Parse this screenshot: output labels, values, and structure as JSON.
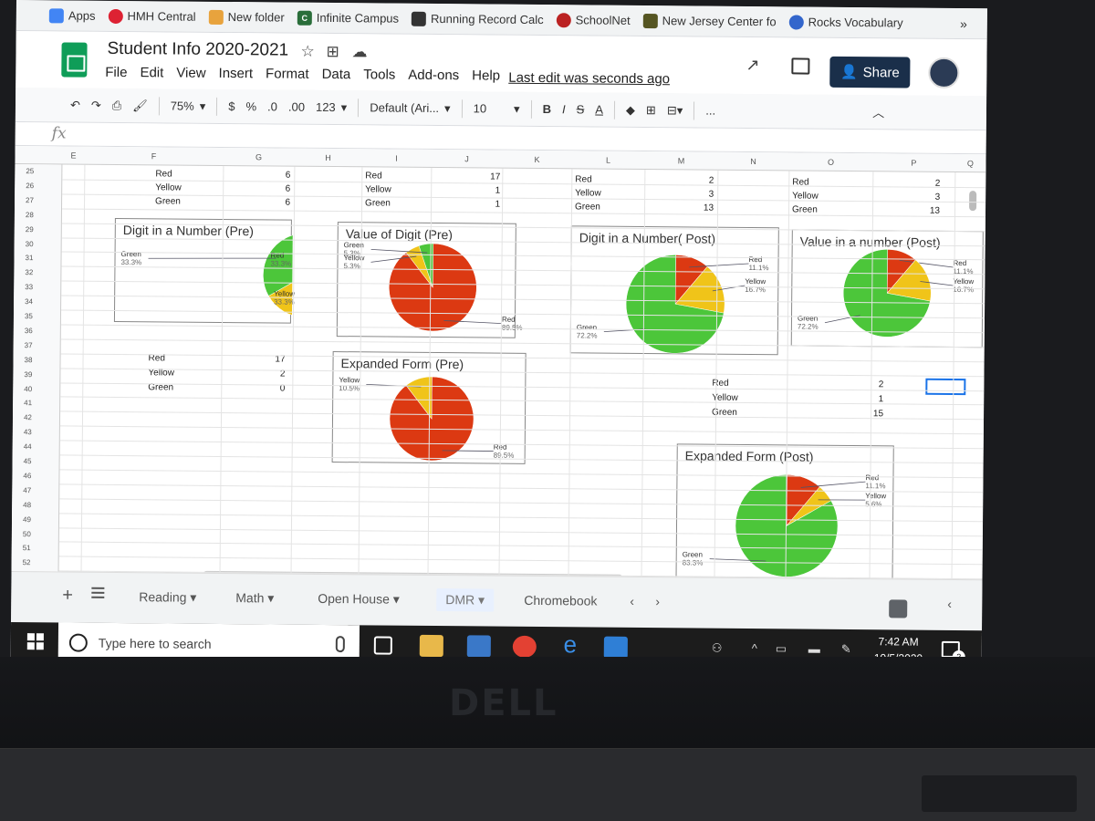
{
  "bookmarks": [
    "Apps",
    "HMH Central",
    "New folder",
    "Infinite Campus",
    "Running Record Calc",
    "SchoolNet",
    "New Jersey Center fo",
    "Rocks Vocabulary"
  ],
  "bookmark_more": "»",
  "doc": {
    "title": "Student Info 2020-2021",
    "menu": [
      "File",
      "Edit",
      "View",
      "Insert",
      "Format",
      "Data",
      "Tools",
      "Add-ons",
      "Help"
    ],
    "last_edit": "Last edit was seconds ago",
    "share": "Share"
  },
  "toolbar": {
    "zoom": "75%",
    "currency": "$",
    "percent": "%",
    "dec_less": ".0",
    "dec_more": ".00",
    "format123": "123",
    "font": "Default (Ari...",
    "size": "10",
    "bold": "B",
    "italic": "I",
    "strike": "S",
    "color_a": "A",
    "more": "..."
  },
  "fx": "fx",
  "columns": [
    "E",
    "F",
    "G",
    "H",
    "I",
    "J",
    "K",
    "L",
    "M",
    "N",
    "O",
    "P",
    "Q"
  ],
  "rows": [
    "25",
    "26",
    "27",
    "28",
    "29",
    "30",
    "31",
    "32",
    "33",
    "34",
    "35",
    "36",
    "37",
    "38",
    "39",
    "40",
    "41",
    "42",
    "43",
    "44",
    "45",
    "46",
    "47",
    "48",
    "49",
    "50",
    "51",
    "52"
  ],
  "cells": [
    {
      "id": "f25",
      "t": "Red"
    },
    {
      "id": "g25",
      "t": "6"
    },
    {
      "id": "f26",
      "t": "Yellow"
    },
    {
      "id": "g26",
      "t": "6"
    },
    {
      "id": "f27",
      "t": "Green"
    },
    {
      "id": "g27",
      "t": "6"
    },
    {
      "id": "i25",
      "t": "Red"
    },
    {
      "id": "j25",
      "t": "17"
    },
    {
      "id": "i26",
      "t": "Yellow"
    },
    {
      "id": "j26",
      "t": "1"
    },
    {
      "id": "i27",
      "t": "Green"
    },
    {
      "id": "j27",
      "t": "1"
    },
    {
      "id": "l25",
      "t": "Red"
    },
    {
      "id": "m25",
      "t": "2"
    },
    {
      "id": "l26",
      "t": "Yellow"
    },
    {
      "id": "m26",
      "t": "3"
    },
    {
      "id": "l27",
      "t": "Green"
    },
    {
      "id": "m27",
      "t": "13"
    },
    {
      "id": "o25",
      "t": "Red"
    },
    {
      "id": "p25",
      "t": "2"
    },
    {
      "id": "o26",
      "t": "Yellow"
    },
    {
      "id": "p26",
      "t": "3"
    },
    {
      "id": "o27",
      "t": "Green"
    },
    {
      "id": "p27",
      "t": "13"
    },
    {
      "id": "f38",
      "t": "Red"
    },
    {
      "id": "g38",
      "t": "17"
    },
    {
      "id": "f39",
      "t": "Yellow"
    },
    {
      "id": "g39",
      "t": "2"
    },
    {
      "id": "f40",
      "t": "Green"
    },
    {
      "id": "g40",
      "t": "0"
    },
    {
      "id": "n39",
      "t": "Red"
    },
    {
      "id": "p39",
      "t": "2"
    },
    {
      "id": "n40",
      "t": "Yellow"
    },
    {
      "id": "p40",
      "t": "1"
    },
    {
      "id": "n41",
      "t": "Green"
    },
    {
      "id": "p41",
      "t": "15"
    }
  ],
  "colors": {
    "red": "#dc3912",
    "yellow": "#f0c419",
    "green": "#4cc63a"
  },
  "chart_data": [
    {
      "type": "pie",
      "title": "Digit in a Number (Pre)",
      "labels": [
        "Red",
        "Yellow",
        "Green"
      ],
      "values": [
        6,
        6,
        6
      ],
      "percent_labels": [
        "33.3%",
        "33.3%",
        "33.3%"
      ]
    },
    {
      "type": "pie",
      "title": "Value of Digit (Pre)",
      "labels": [
        "Red",
        "Yellow",
        "Green"
      ],
      "values": [
        17,
        1,
        1
      ],
      "percent_labels": [
        "89.5%",
        "5.3%",
        "5.3%"
      ]
    },
    {
      "type": "pie",
      "title": "Digit in a Number( Post)",
      "labels": [
        "Red",
        "Yellow",
        "Green"
      ],
      "values": [
        2,
        3,
        13
      ],
      "percent_labels": [
        "11.1%",
        "16.7%",
        "72.2%"
      ]
    },
    {
      "type": "pie",
      "title": "Value in a number (Post)",
      "labels": [
        "Red",
        "Yellow",
        "Green"
      ],
      "values": [
        2,
        3,
        13
      ],
      "percent_labels": [
        "11.1%",
        "16.7%",
        "72.2%"
      ]
    },
    {
      "type": "pie",
      "title": "Expanded Form (Pre)",
      "labels": [
        "Red",
        "Yellow",
        "Green"
      ],
      "values": [
        17,
        2,
        0
      ],
      "percent_labels": [
        "89.5%",
        "10.5%",
        ""
      ]
    },
    {
      "type": "pie",
      "title": "Expanded Form (Post)",
      "labels": [
        "Red",
        "Yellow",
        "Green"
      ],
      "values": [
        2,
        1,
        15
      ],
      "percent_labels": [
        "11.1%",
        "5.6%",
        "83.3%"
      ]
    }
  ],
  "tabs": [
    "Reading",
    "Math",
    "Open House",
    "DMR",
    "Chromebook"
  ],
  "taskbar": {
    "search": "Type here to search",
    "time": "7:42 AM",
    "date": "10/5/2020",
    "notifications": "2"
  }
}
